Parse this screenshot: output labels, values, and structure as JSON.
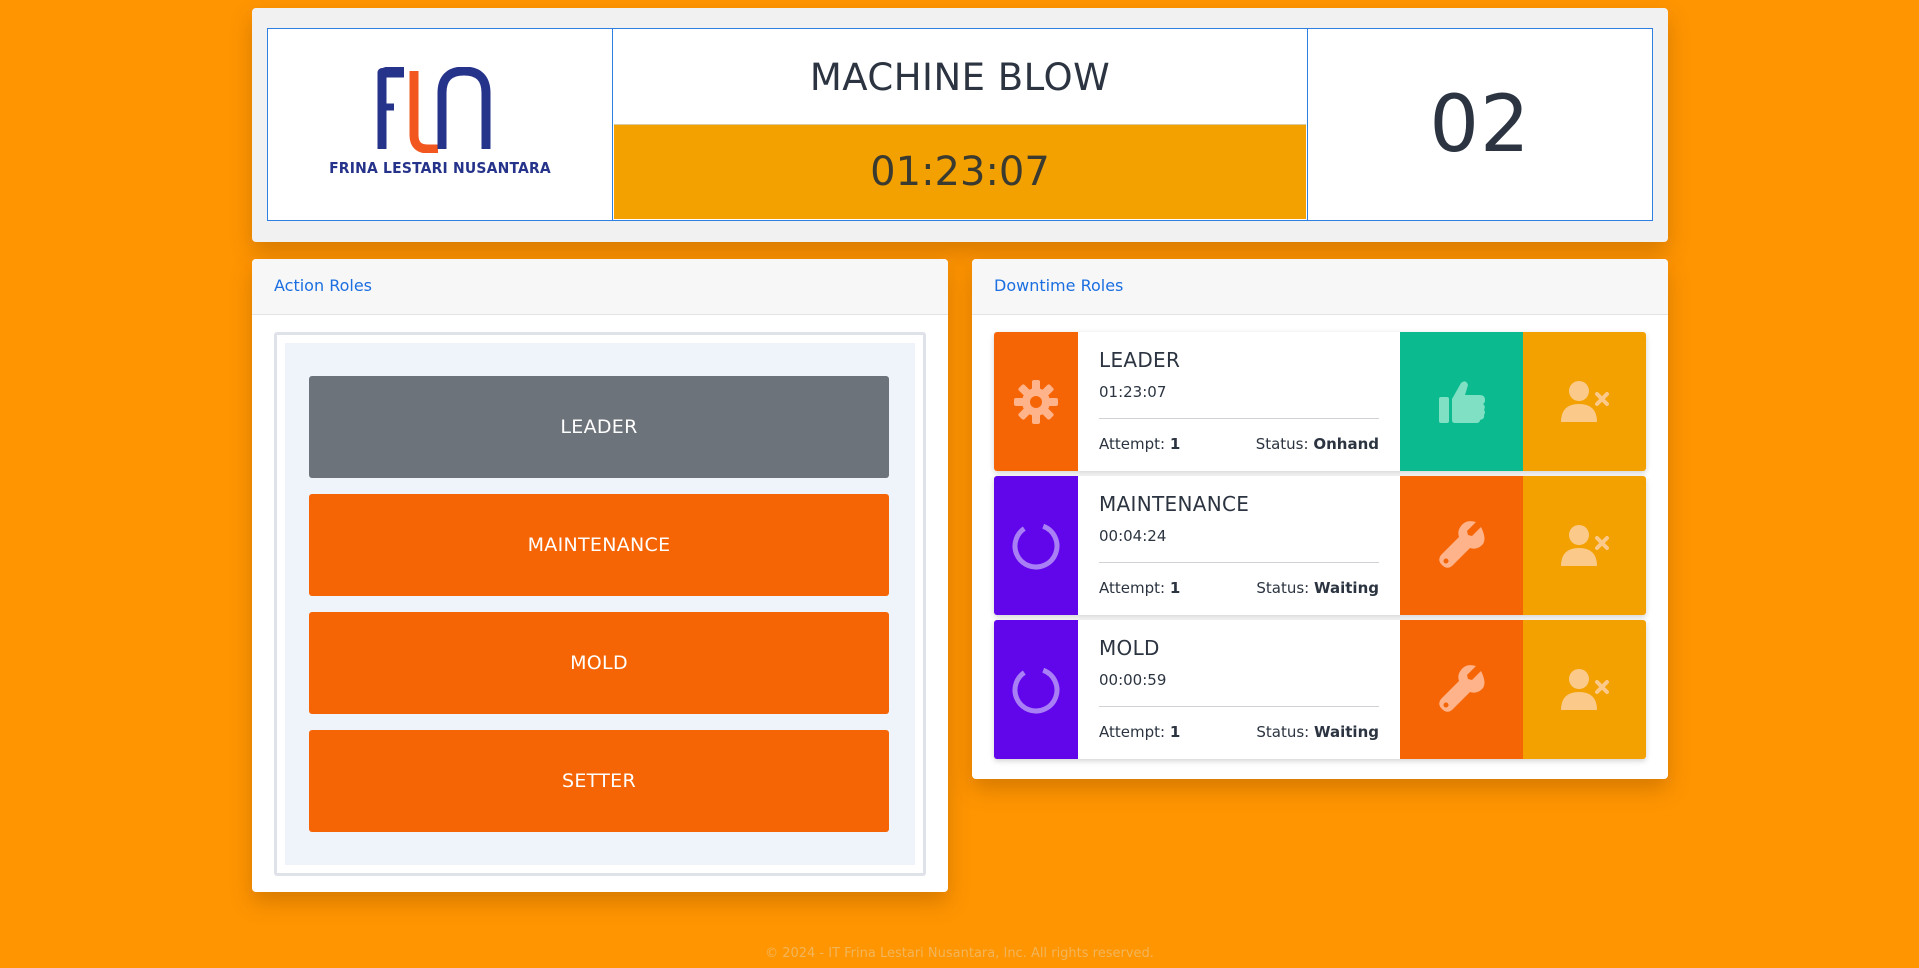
{
  "header": {
    "logo_text": "FRINA LESTARI NUSANTARA",
    "machine_title": "MACHINE BLOW",
    "timer": "01:23:07",
    "machine_number": "02"
  },
  "action_panel": {
    "title": "Action Roles",
    "buttons": [
      {
        "label": "LEADER",
        "color": "#6c737a"
      },
      {
        "label": "MAINTENANCE",
        "color": "#f66505"
      },
      {
        "label": "MOLD",
        "color": "#f66505"
      },
      {
        "label": "SETTER",
        "color": "#f66505"
      }
    ]
  },
  "downtime_panel": {
    "title": "Downtime Roles",
    "attempt_label": "Attempt:",
    "status_label": "Status:",
    "rows": [
      {
        "name": "LEADER",
        "time": "01:23:07",
        "attempt": "1",
        "status": "Onhand",
        "icon": "gear-icon",
        "icon_bg": "#f66505",
        "action_icon": "thumbs-up-icon",
        "action_bg": "#0bba8f"
      },
      {
        "name": "MAINTENANCE",
        "time": "00:04:24",
        "attempt": "1",
        "status": "Waiting",
        "icon": "spinner-icon",
        "icon_bg": "#6105ea",
        "action_icon": "wrench-icon",
        "action_bg": "#f66505"
      },
      {
        "name": "MOLD",
        "time": "00:00:59",
        "attempt": "1",
        "status": "Waiting",
        "icon": "spinner-icon",
        "icon_bg": "#6105ea",
        "action_icon": "wrench-icon",
        "action_bg": "#f66505"
      }
    ]
  },
  "footer": {
    "text": "© 2024 - IT Frina Lestari Nusantara, Inc. All rights reserved."
  },
  "colors": {
    "background": "#ff9501",
    "accent_blue": "#1b6fe0",
    "timer_bar": "#f2a101",
    "remove_user_bg": "#f2a101"
  }
}
